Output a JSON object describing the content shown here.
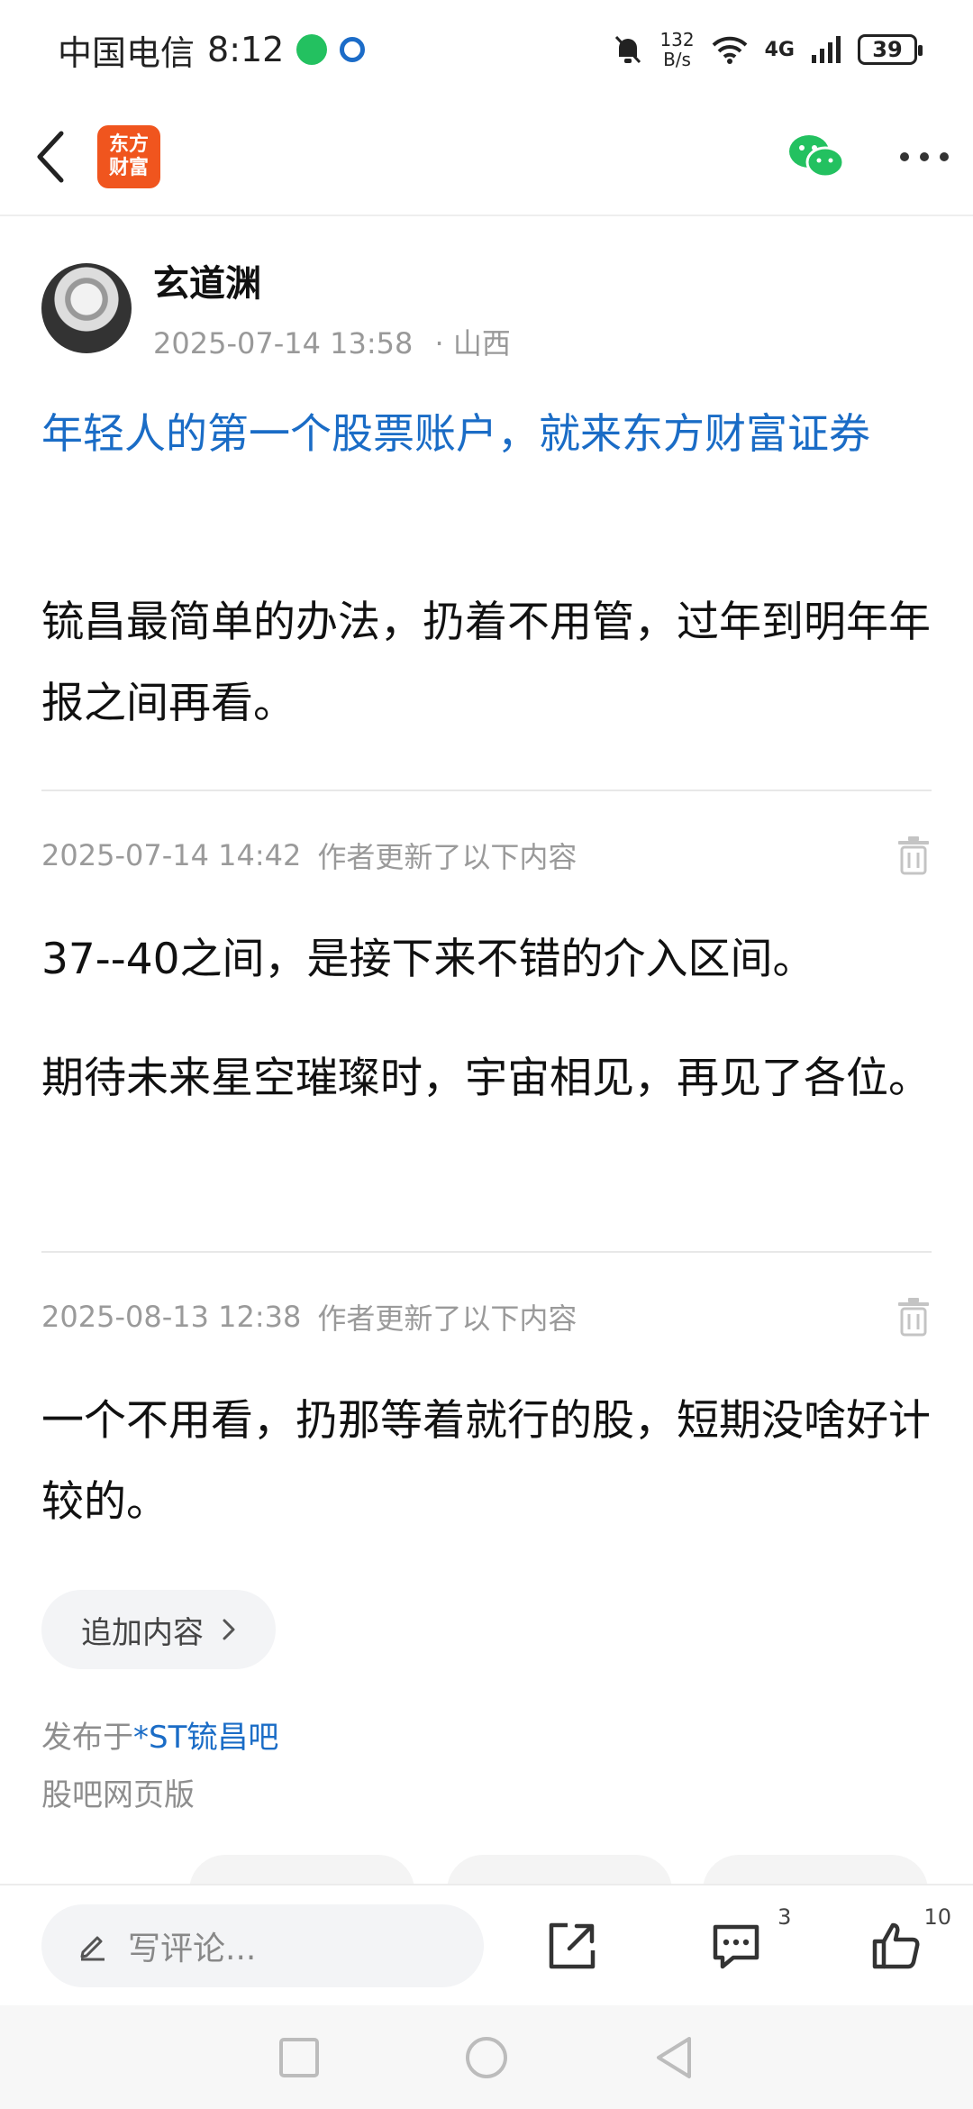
{
  "status": {
    "carrier": "中国电信",
    "time": "8:12",
    "speed_value": "132",
    "speed_unit": "B/s",
    "network": "4G",
    "battery": "39"
  },
  "header": {
    "logo_line1": "东方",
    "logo_line2": "财富"
  },
  "author": {
    "name": "玄道渊",
    "time": "2025-07-14 13:58",
    "location": "· 山西"
  },
  "promo": "年轻人的第一个股票账户，就来东方财富证券",
  "body": "锍昌最简单的办法，扔着不用管，过年到明年年报之间再看。",
  "updates": [
    {
      "time": "2025-07-14 14:42",
      "label": "作者更新了以下内容",
      "p1": "37--40之间，是接下来不错的介入区间。",
      "p2": "期待未来星空璀璨时，宇宙相见，再见了各位。"
    },
    {
      "time": "2025-08-13 12:38",
      "label": "作者更新了以下内容",
      "p1": "一个不用看，扔那等着就行的股，短期没啥好计较的。"
    }
  ],
  "add_content": "追加内容",
  "published_prefix": "发布于",
  "published_bar": "*ST锍昌吧",
  "web_version": "股吧网页版",
  "bottom": {
    "comment_placeholder": "写评论...",
    "comment_count": "3",
    "like_count": "10"
  },
  "colors": {
    "link": "#1a6cc6",
    "logo": "#f0551e",
    "wechat": "#23c160"
  }
}
